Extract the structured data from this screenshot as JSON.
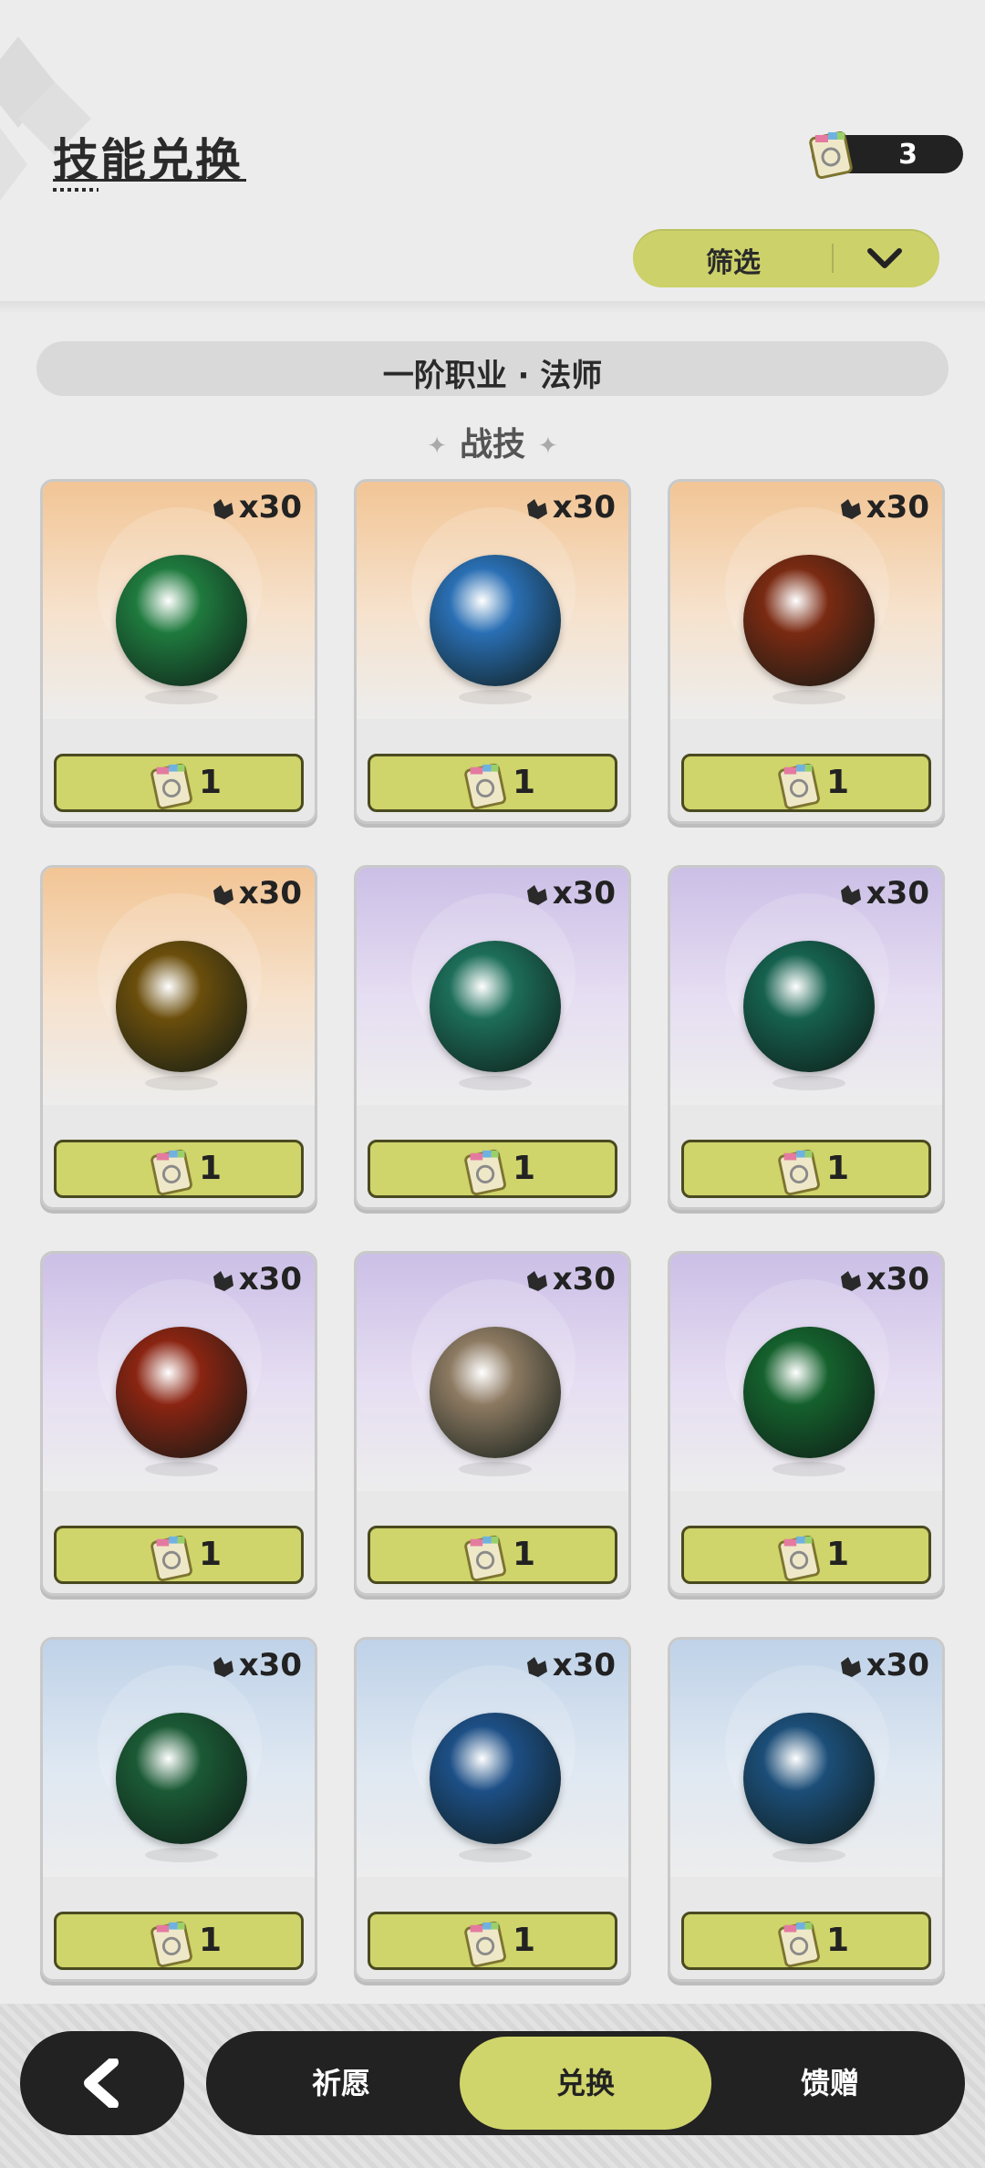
{
  "header": {
    "title": "技能兑换",
    "currency_count": "3",
    "filter_label": "筛选"
  },
  "section": {
    "title": "一阶职业 · 法师",
    "subtitle": "战技"
  },
  "skills": [
    {
      "qty": "x30",
      "price": "1",
      "rarity": "orange",
      "icon": "green-wind-flame-skill-icon",
      "color": "#1f7a3e"
    },
    {
      "qty": "x30",
      "price": "1",
      "rarity": "orange",
      "icon": "ice-burst-skill-icon",
      "color": "#2a6fb4"
    },
    {
      "qty": "x30",
      "price": "1",
      "rarity": "orange",
      "icon": "fire-swirl-skill-icon",
      "color": "#7a2a12"
    },
    {
      "qty": "x30",
      "price": "1",
      "rarity": "orange",
      "icon": "golden-crystal-skill-icon",
      "color": "#6b4e0c"
    },
    {
      "qty": "x30",
      "price": "1",
      "rarity": "purple",
      "icon": "green-wind-blades-skill-icon",
      "color": "#1d6e5a"
    },
    {
      "qty": "x30",
      "price": "1",
      "rarity": "purple",
      "icon": "green-vortex-skill-icon",
      "color": "#16614f"
    },
    {
      "qty": "x30",
      "price": "1",
      "rarity": "purple",
      "icon": "fireball-skill-icon",
      "color": "#8a2412"
    },
    {
      "qty": "x30",
      "price": "1",
      "rarity": "purple",
      "icon": "earth-rock-skill-icon",
      "color": "#8d7a62"
    },
    {
      "qty": "x30",
      "price": "1",
      "rarity": "purple",
      "icon": "green-heal-plus-skill-icon",
      "color": "#15612d"
    },
    {
      "qty": "x30",
      "price": "1",
      "rarity": "blue",
      "icon": "thorn-vine-skill-icon",
      "color": "#1b5a35"
    },
    {
      "qty": "x30",
      "price": "1",
      "rarity": "blue",
      "icon": "water-orb-skill-icon",
      "color": "#1d4f86"
    },
    {
      "qty": "x30",
      "price": "1",
      "rarity": "blue",
      "icon": "ice-crystal-skill-icon",
      "color": "#1c4e78"
    }
  ],
  "nav": {
    "back_icon": "back-arrow-icon",
    "tabs": [
      "祈愿",
      "兑换",
      "馈赠"
    ],
    "active_tab": "兑换"
  }
}
